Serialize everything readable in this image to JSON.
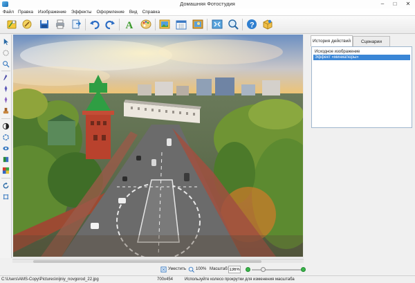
{
  "window": {
    "title": "Домашняя Фотостудия",
    "controls": [
      "–",
      "□",
      "✕"
    ]
  },
  "menu": [
    "Файл",
    "Правка",
    "Изображение",
    "Эффекты",
    "Оформление",
    "Вид",
    "Справка"
  ],
  "toolbar": {
    "buttons": [
      "open-wizard",
      "magic-brush",
      "save",
      "print",
      "export",
      "undo",
      "redo",
      "text",
      "palette",
      "frame",
      "calendar",
      "collage",
      "fit-screen",
      "zoom-search",
      "help",
      "package"
    ]
  },
  "left_tools": [
    "pointer",
    "crop-circle",
    "magnifier",
    "pipette",
    "brush",
    "eraser-brush",
    "clone-stamp",
    "contrast",
    "blur",
    "sharpen",
    "color-balance",
    "color-channels",
    "rotate",
    "perspective"
  ],
  "right_panel": {
    "tabs": [
      "История действий",
      "Сценарии"
    ],
    "history": [
      "Исходное изображение",
      "Эффект «миниатюры»"
    ]
  },
  "zoom_bar": {
    "fit_label": "Уместить",
    "actual_label": "100%",
    "scale_label": "Масштаб:",
    "scale_value": "136%",
    "slider_fraction": 0.22
  },
  "status_bar": {
    "path": "C:\\Users\\AMS-Copy\\Pictures\\nijniy_novgorod_22.jpg",
    "size": "700x454",
    "hint": "Используйте колесо прокрутки для изменения масштаба"
  },
  "colors": {
    "accent": "#3a86d6",
    "slider_dot": "#3ab54a",
    "tower_roof": "#2f9e43",
    "tower_wall": "#b9422d"
  }
}
